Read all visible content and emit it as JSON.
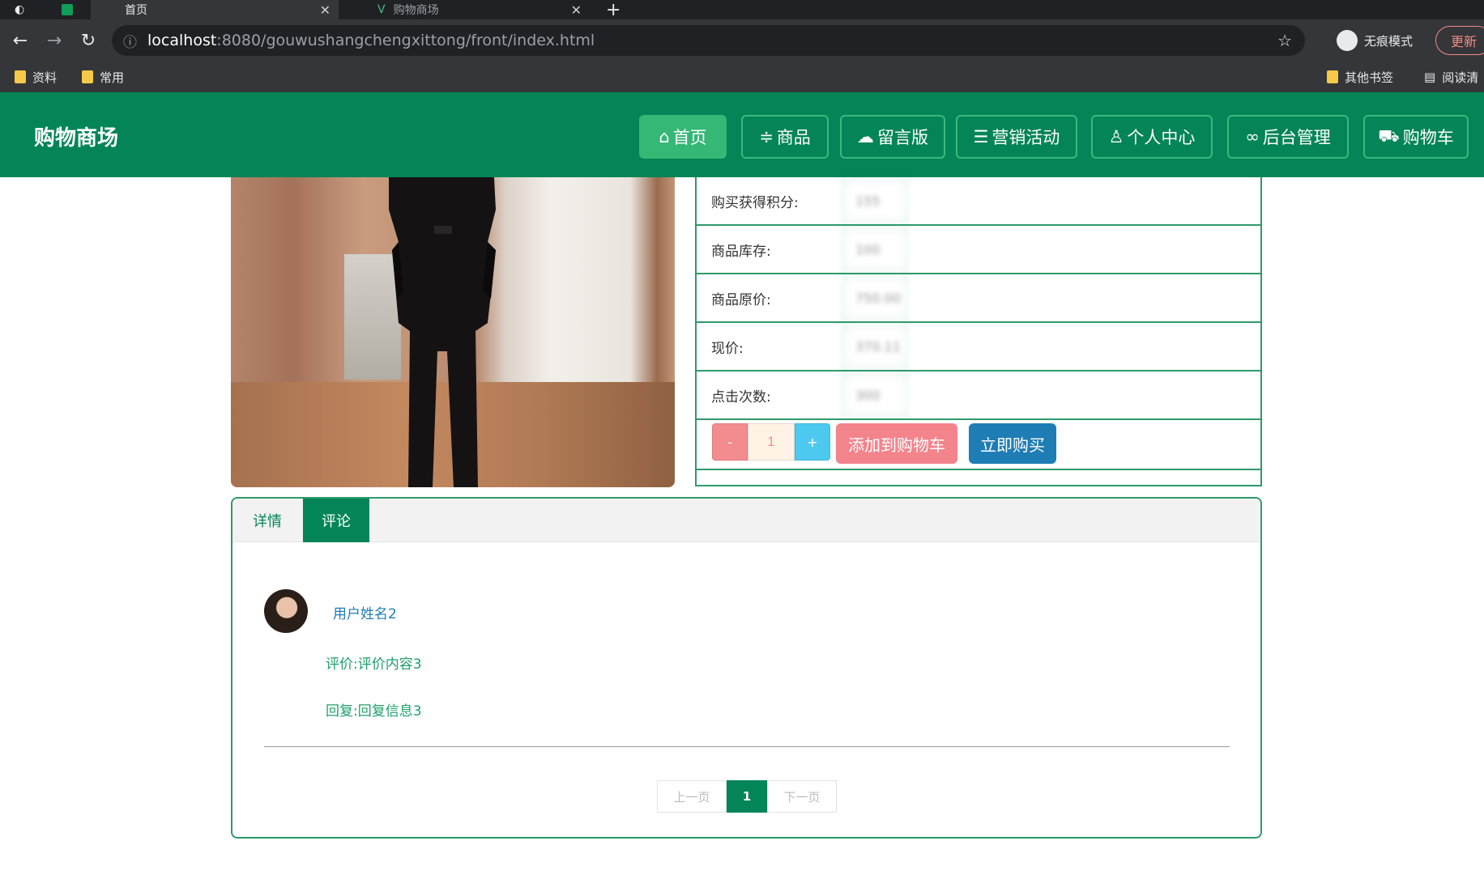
{
  "browser": {
    "tabs": [
      {
        "label": "首页"
      },
      {
        "label": "购物商场"
      }
    ],
    "url": {
      "host": "localhost",
      "path": ":8080/gouwushangchengxittong/front/index.html"
    },
    "incognito_label": "无痕模式",
    "update_label": "更新",
    "bookmarks": [
      "资料",
      "常用"
    ],
    "other_bookmarks": "其他书签",
    "reading_list": "阅读清"
  },
  "site": {
    "brand": "购物商场",
    "nav": [
      {
        "label": "首页",
        "icon": "home-icon"
      },
      {
        "label": "商品",
        "icon": "sliders-icon"
      },
      {
        "label": "留言版",
        "icon": "chat-icon"
      },
      {
        "label": "营销活动",
        "icon": "layers-icon"
      },
      {
        "label": "个人中心",
        "icon": "user-icon"
      },
      {
        "label": "后台管理",
        "icon": "link-icon"
      },
      {
        "label": "购物车",
        "icon": "cart-icon"
      }
    ],
    "active_nav": "首页",
    "accent": "#038557"
  },
  "product": {
    "fields": [
      {
        "label": "购买获得积分:",
        "value": "155"
      },
      {
        "label": "商品库存:",
        "value": "100"
      },
      {
        "label": "商品原价:",
        "value": "750.00"
      },
      {
        "label": "现价:",
        "value": "370.11"
      },
      {
        "label": "点击次数:",
        "value": "300"
      }
    ],
    "quantity": "1",
    "minus_label": "-",
    "plus_label": "+",
    "add_to_cart": "添加到购物车",
    "buy_now": "立即购买"
  },
  "tabs": {
    "detail": "详情",
    "comments": "评论",
    "active": "评论"
  },
  "comments": [
    {
      "user": "用户姓名2",
      "content": "评价:评价内容3",
      "reply": "回复:回复信息3"
    }
  ],
  "pager": {
    "prev": "上一页",
    "current": "1",
    "next": "下一页"
  }
}
